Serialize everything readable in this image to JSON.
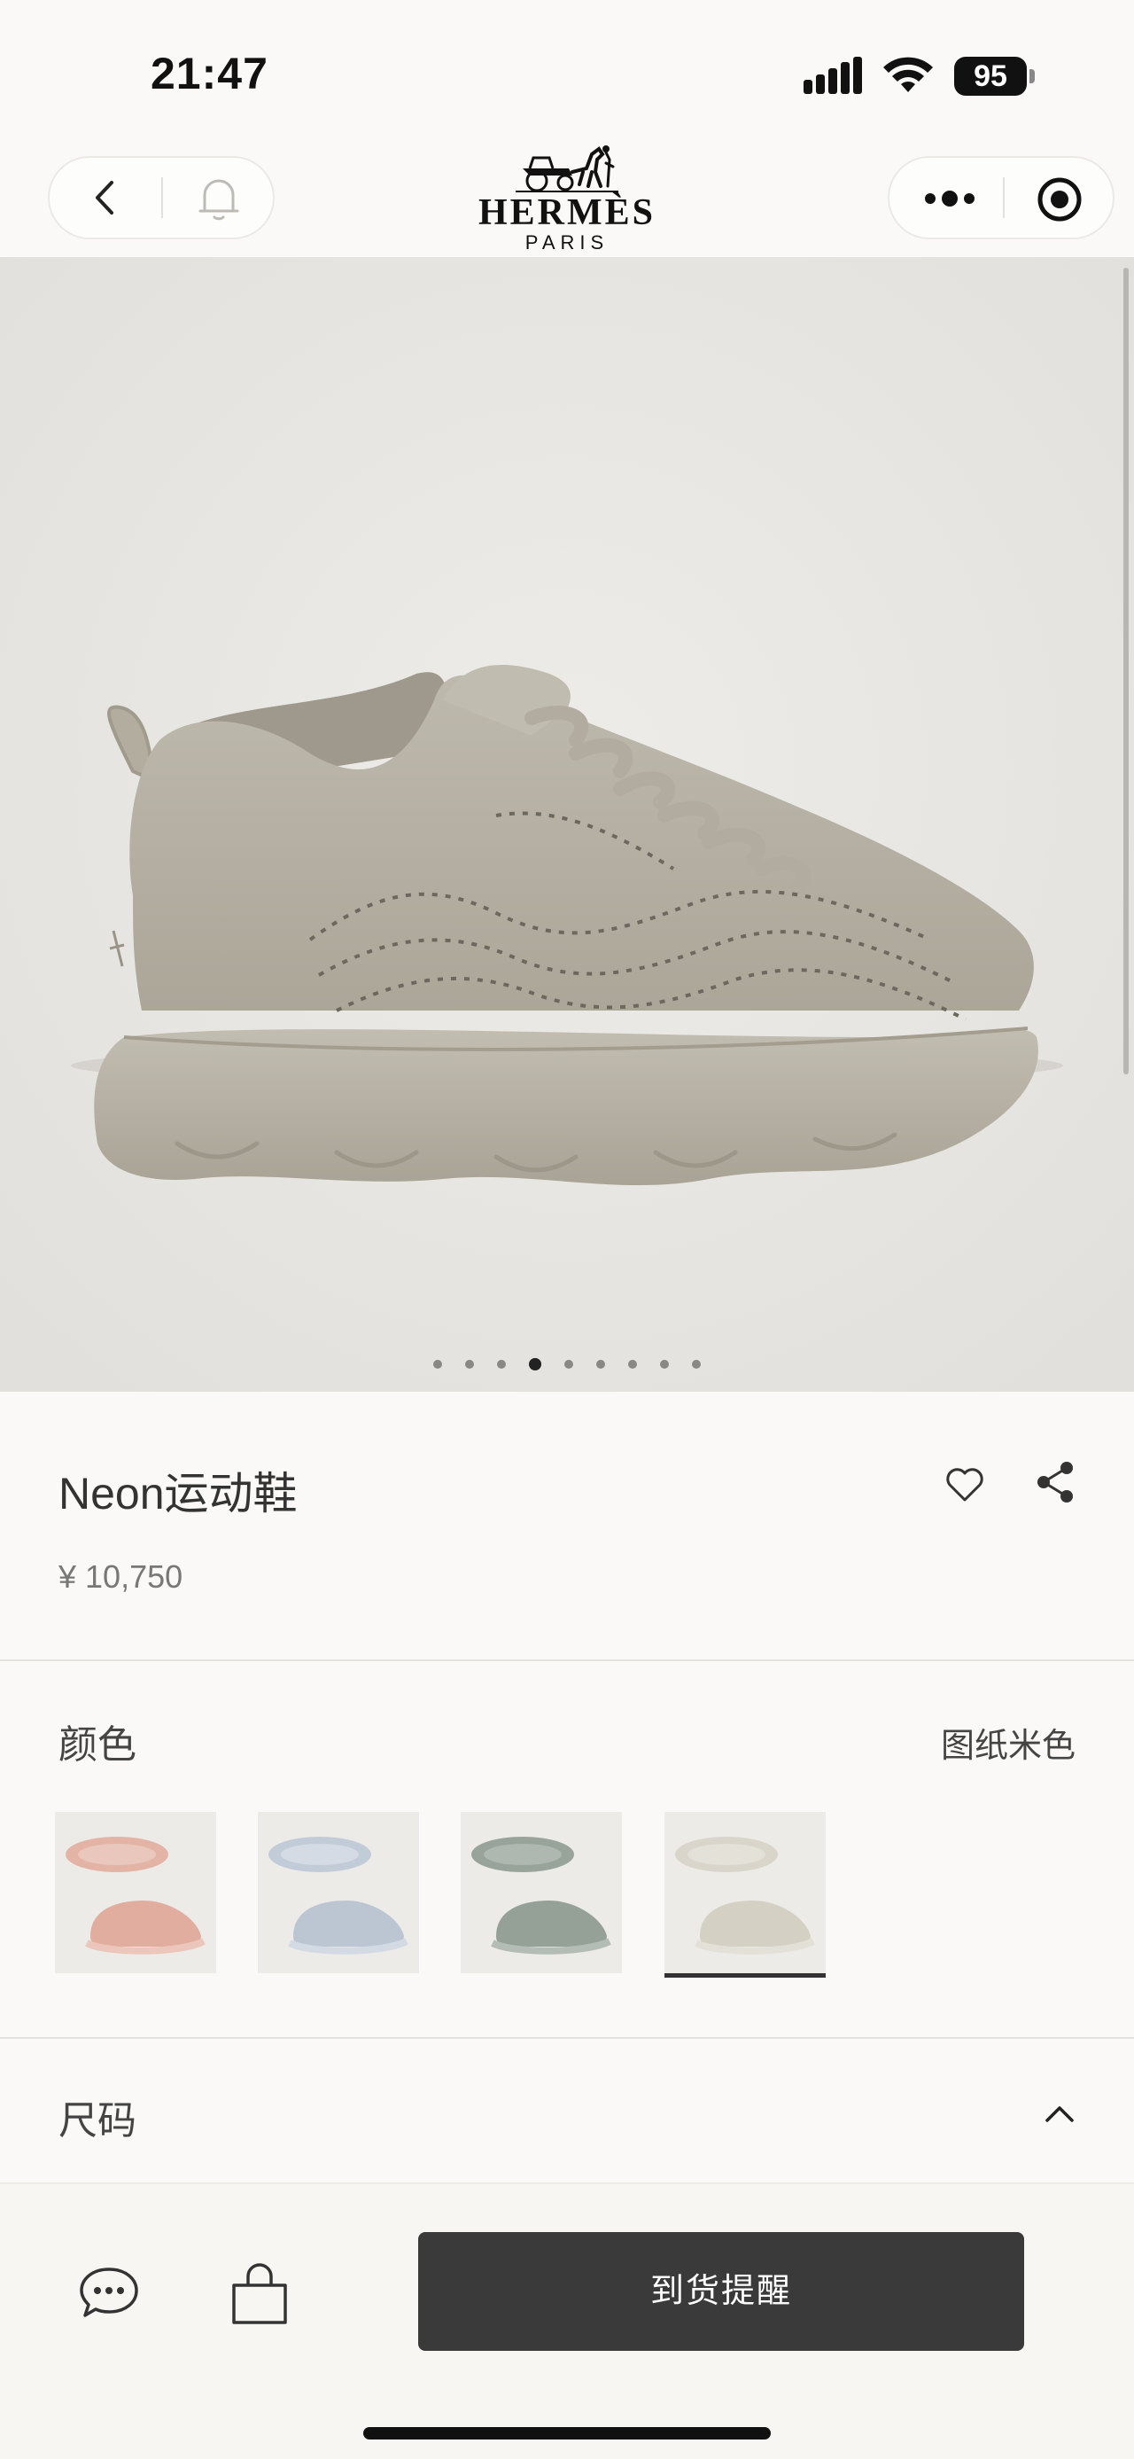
{
  "status_bar": {
    "time": "21:47",
    "battery": "95"
  },
  "nav": {
    "brand": "HERMÈS",
    "brand_sub": "PARIS"
  },
  "gallery": {
    "image_count": 9,
    "active_index": 3
  },
  "product": {
    "name": "Neon运动鞋",
    "price": "¥ 10,750"
  },
  "color": {
    "label": "颜色",
    "selected": "图纸米色",
    "swatches": [
      {
        "shoe": "#e2b7a8",
        "sole": "#e8c4b8",
        "bg": "#ecebe8"
      },
      {
        "shoe": "#c6cfdb",
        "sole": "#d3dae3",
        "bg": "#ecebe8"
      },
      {
        "shoe": "#9ea9a0",
        "sole": "#b4bdb5",
        "bg": "#ecebe8"
      },
      {
        "shoe": "#d9d6cc",
        "sole": "#e3e0d7",
        "bg": "#ecebe8"
      }
    ],
    "selected_index": 3
  },
  "size": {
    "label": "尺码"
  },
  "actions": {
    "notify_label": "到货提醒"
  },
  "colors": {
    "accent": "#3a3a3a",
    "background": "#faf9f7",
    "hero_background": "#e9e7e3",
    "shoe": "#b6b1a4"
  }
}
